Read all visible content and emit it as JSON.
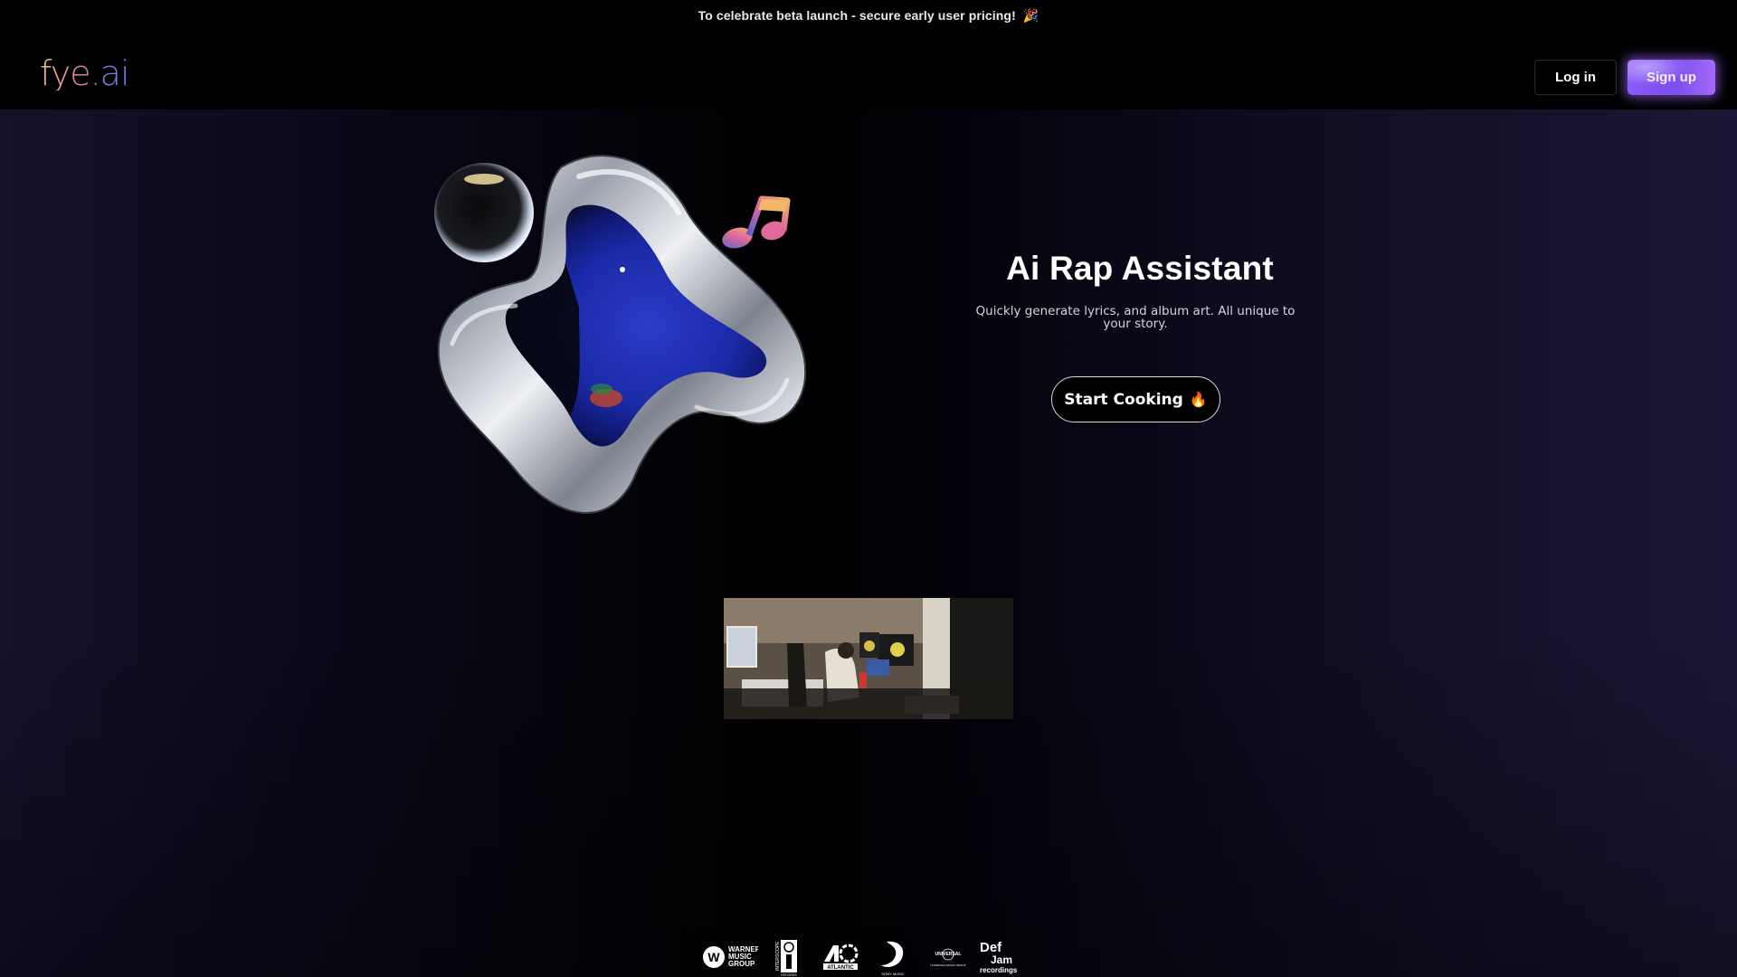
{
  "announcement": {
    "text": "To celebrate beta launch - secure early user pricing!",
    "emoji": "🎉",
    "emoji_name": "party-popper-icon"
  },
  "header": {
    "logo": "fye.ai",
    "login_label": "Log in",
    "signup_label": "Sign up"
  },
  "hero": {
    "title": "Ai Rap Assistant",
    "subtitle": "Quickly generate lyrics, and album art. All unique to your story.",
    "cta_label": "Start Cooking",
    "cta_emoji": "🔥"
  },
  "labels": [
    {
      "name": "Warner Music Group",
      "line1": "WARNER",
      "line2": "MUSIC",
      "line3": "GROUP"
    },
    {
      "name": "Interscope Records",
      "side": "INTERSCOPE",
      "bottom": "RECORDS"
    },
    {
      "name": "Atlantic",
      "text": "ATLANTIC"
    },
    {
      "name": "Sony Music",
      "text": "SONY MUSIC"
    },
    {
      "name": "Universal Music Group",
      "top": "UNIVERSAL",
      "bottom": "UNIVERSAL MUSIC GROUP"
    },
    {
      "name": "Def Jam Recordings",
      "top": "Def",
      "mid": "Jam",
      "bottom": "recordings"
    }
  ],
  "colors": {
    "accent": "#8b5cf6",
    "background_edge": "#1c1535",
    "background_center": "#000000"
  }
}
